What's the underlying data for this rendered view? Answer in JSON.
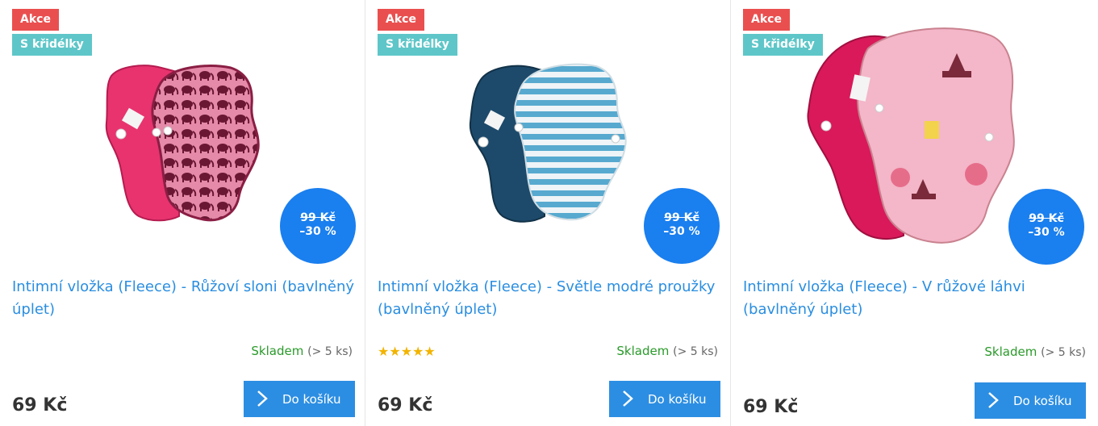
{
  "products": [
    {
      "flags": [
        "Akce",
        "S křidélky"
      ],
      "old_price": "99 Kč",
      "discount": "–30 %",
      "name": "Intimní vložka (Fleece) - Růžoví sloni (bavlněný úplet)",
      "rating": "",
      "stock_status": "Skladem",
      "stock_amount": "(> 5 ks)",
      "price": "69 Kč",
      "cart_label": "Do košíku",
      "image_colors": {
        "back": "#e8336f",
        "front": "#c2366e",
        "pattern": "#6a1733"
      }
    },
    {
      "flags": [
        "Akce",
        "S křidélky"
      ],
      "old_price": "99 Kč",
      "discount": "–30 %",
      "name": "Intimní vložka (Fleece) - Světle modré proužky (bavlněný úplet)",
      "rating": "★★★★★",
      "stock_status": "Skladem",
      "stock_amount": "(> 5 ks)",
      "price": "69 Kč",
      "cart_label": "Do košíku",
      "image_colors": {
        "back": "#1d4a6b",
        "front": "#eef4f7",
        "pattern": "#57a9cf"
      }
    },
    {
      "flags": [
        "Akce",
        "S křidélky"
      ],
      "old_price": "99 Kč",
      "discount": "–30 %",
      "name": "Intimní vložka (Fleece) - V růžové láhvi (bavlněný úplet)",
      "rating": "",
      "stock_status": "Skladem",
      "stock_amount": "(> 5 ks)",
      "price": "69 Kč",
      "cart_label": "Do košíku",
      "image_colors": {
        "back": "#d9195a",
        "front": "#f4b6c9",
        "pattern": "#7a2a3a"
      }
    }
  ],
  "colors": {
    "sale_flag": "#ea4f4f",
    "wings_flag": "#5ec6c8",
    "discount_badge": "#1a7fef",
    "link": "#2a8ee0",
    "in_stock": "#2a9a2a",
    "cart_button": "#2c8ee2",
    "stars": "#f2b400"
  }
}
